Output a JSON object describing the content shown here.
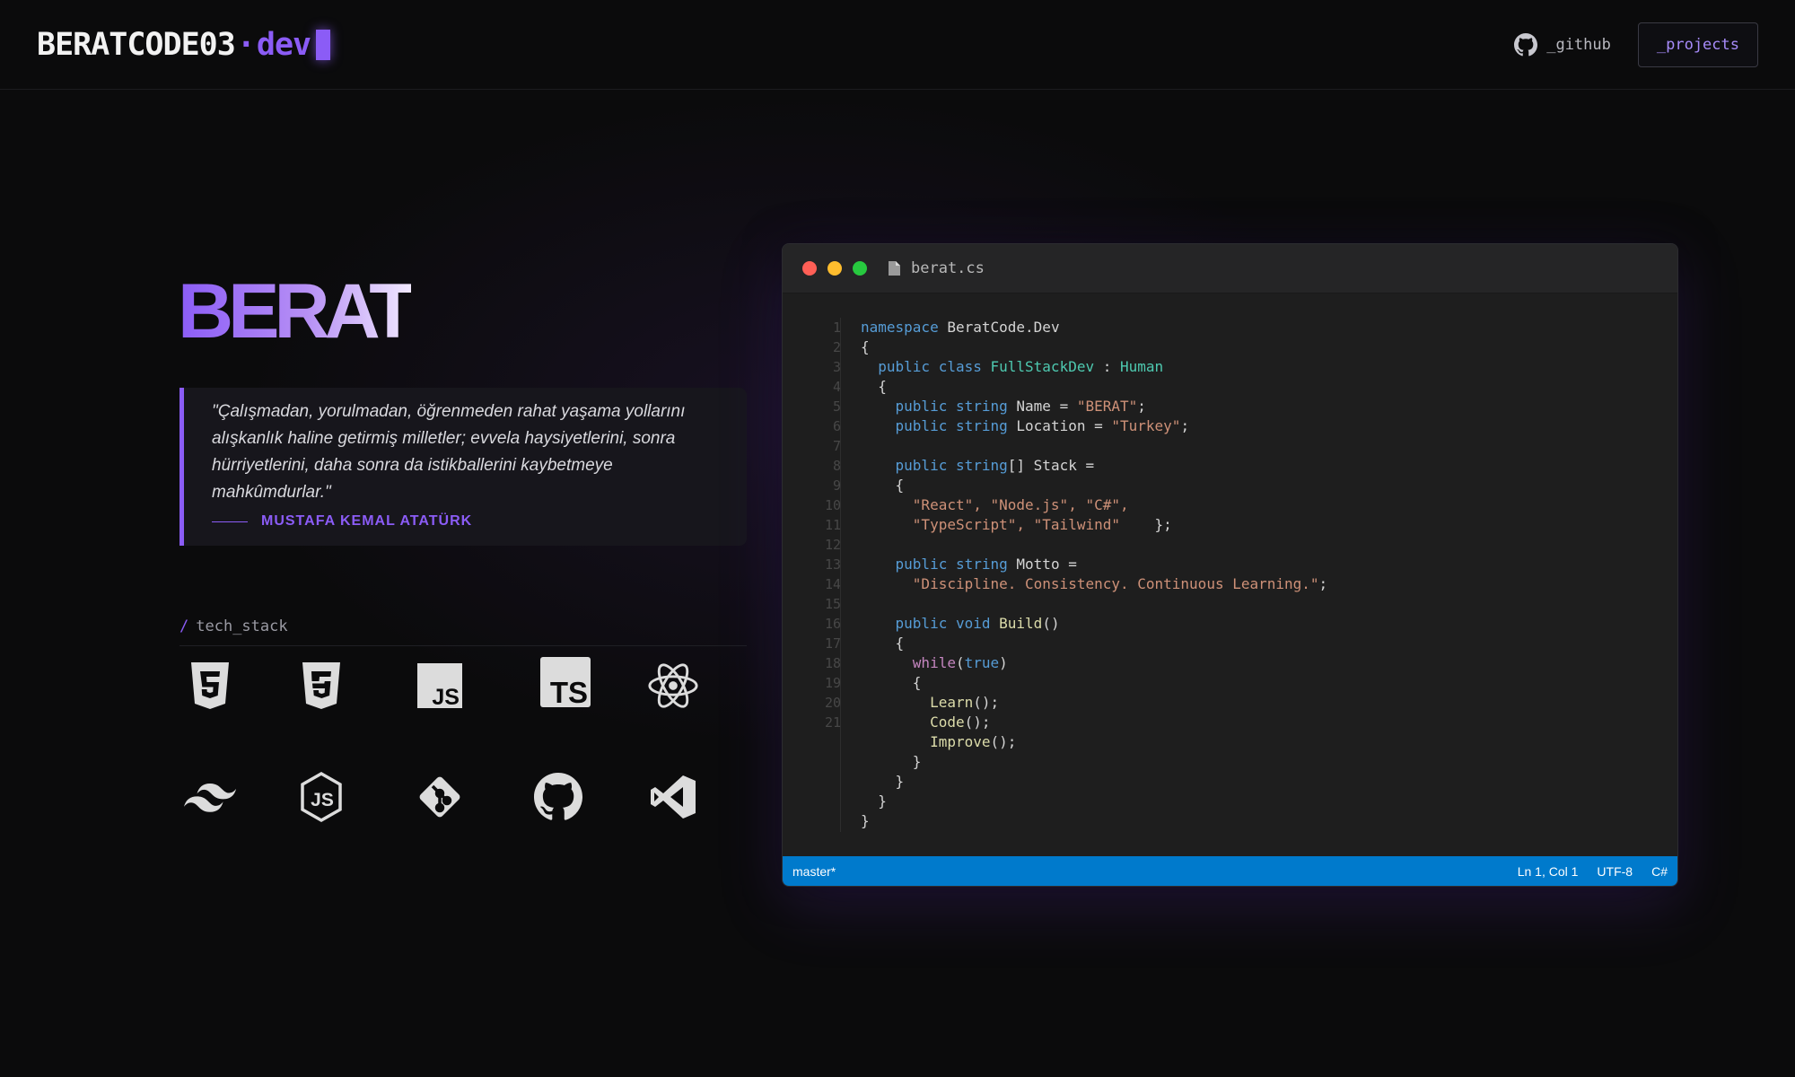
{
  "header": {
    "logo_name": "BERATCODE03",
    "logo_dot": "·",
    "logo_ext": "dev",
    "nav_github": "_github",
    "nav_projects": "_projects"
  },
  "hero": {
    "name": "BERAT",
    "quote": "\"Çalışmadan, yorulmadan, öğrenmeden rahat yaşama yollarını alışkanlık haline getirmiş milletler; evvela haysiyetlerini, sonra hürriyetlerini, daha sonra da istikballerini kaybetmeye mahkûmdurlar.\"",
    "quote_author": "MUSTAFA KEMAL ATATÜRK"
  },
  "tech_stack": {
    "slash": "/",
    "label": "tech_stack",
    "icons": [
      "html5-icon",
      "css3-icon",
      "javascript-icon",
      "typescript-icon",
      "react-icon",
      "tailwind-icon",
      "nodejs-icon",
      "git-icon",
      "github-icon",
      "vscode-icon"
    ]
  },
  "editor": {
    "filename": "berat.cs",
    "line_numbers": "1\n2\n3\n4\n5\n6\n7\n8\n9\n10\n11\n12\n13\n14\n15\n16\n17\n18\n19\n20\n21",
    "code": {
      "ns_kw": "namespace",
      "ns_name": "BeratCode.Dev",
      "class_decl_kw": "public class",
      "class_name": "FullStackDev",
      "base_type": "Human",
      "public_string": "public string",
      "name_prop": "Name",
      "name_value": "\"BERAT\"",
      "location_prop": "Location",
      "location_value": "\"Turkey\"",
      "stack_prop": "Stack",
      "stack_values_1": "\"React\", \"Node.js\", \"C#\",",
      "stack_values_2": "\"TypeScript\", \"Tailwind\"",
      "motto_prop": "Motto",
      "motto_value": "\"Discipline. Consistency. Continuous Learning.\"",
      "public_void": "public void",
      "build_fn": "Build",
      "while_kw": "while",
      "true_kw": "true",
      "learn_fn": "Learn",
      "code_fn": "Code",
      "improve_fn": "Improve"
    },
    "status": {
      "branch": "master*",
      "position": "Ln 1, Col 1",
      "encoding": "UTF-8",
      "language": "C#"
    }
  },
  "colors": {
    "accent": "#8b5cf6",
    "statusbar": "#007acc",
    "background": "#0b0b0c"
  }
}
